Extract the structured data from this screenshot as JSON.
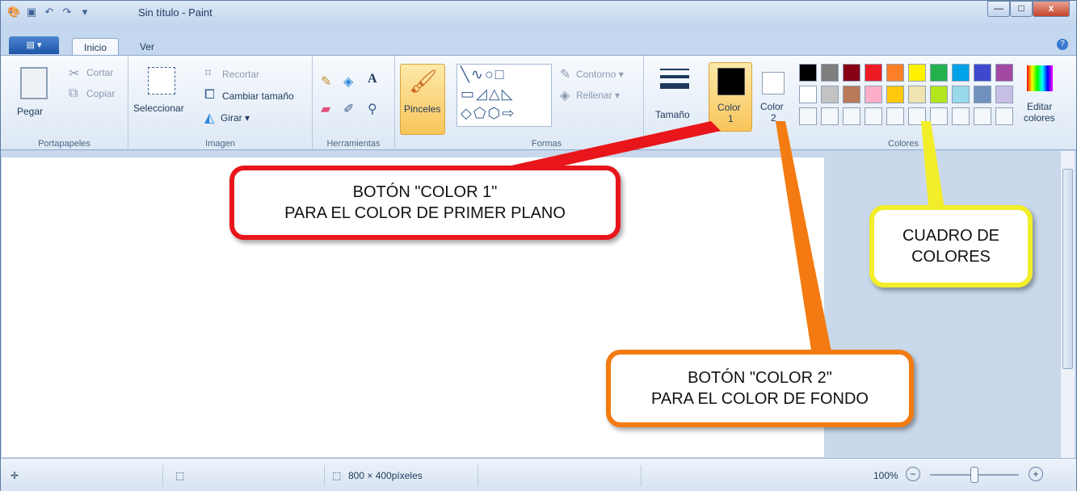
{
  "window": {
    "title": "Sin título - Paint",
    "minimize": "—",
    "maximize": "□",
    "close": "x"
  },
  "tabs": [
    {
      "label": "Inicio",
      "active": true
    },
    {
      "label": "Ver",
      "active": false
    }
  ],
  "app_button": "▤ ▾",
  "help_icon": "?",
  "ribbon": {
    "clipboard": {
      "paste": "Pegar",
      "cut": "Cortar",
      "copy": "Copiar",
      "label": "Portapapeles"
    },
    "image": {
      "select": "Seleccionar",
      "crop": "Recortar",
      "resize": "Cambiar tamaño",
      "rotate": "Girar ▾",
      "label": "Imagen"
    },
    "tools": {
      "label": "Herramientas"
    },
    "brushes": {
      "label": "Pinceles"
    },
    "shapes": {
      "outline": "Contorno ▾",
      "fill": "Rellenar ▾",
      "label": "Formas"
    },
    "size": {
      "label": "Tamaño"
    },
    "color1": {
      "label": "Color",
      "num": "1",
      "color": "#000000"
    },
    "color2": {
      "label": "Color",
      "num": "2",
      "color": "#ffffff"
    },
    "colors": {
      "label": "Colores",
      "edit": "Editar",
      "edit2": "colores",
      "row1": [
        "#000000",
        "#7f7f7f",
        "#880015",
        "#ed1c24",
        "#ff7f27",
        "#fff200",
        "#22b14c",
        "#00a2e8",
        "#3f48cc",
        "#a349a4"
      ],
      "row2": [
        "#ffffff",
        "#c3c3c3",
        "#b97a57",
        "#ffaec9",
        "#ffc90e",
        "#efe4b0",
        "#b5e61d",
        "#99d9ea",
        "#7092be",
        "#c8bfe7"
      ]
    }
  },
  "callouts": {
    "c1_line1": "BOTÓN \"COLOR 1\"",
    "c1_line2": "PARA EL COLOR DE PRIMER PLANO",
    "c2_line1": "BOTÓN \"COLOR 2\"",
    "c2_line2": "PARA EL COLOR DE FONDO",
    "c3_line1": "CUADRO DE",
    "c3_line2": "COLORES"
  },
  "status": {
    "size": "800 × 400píxeles",
    "zoom": "100%"
  }
}
